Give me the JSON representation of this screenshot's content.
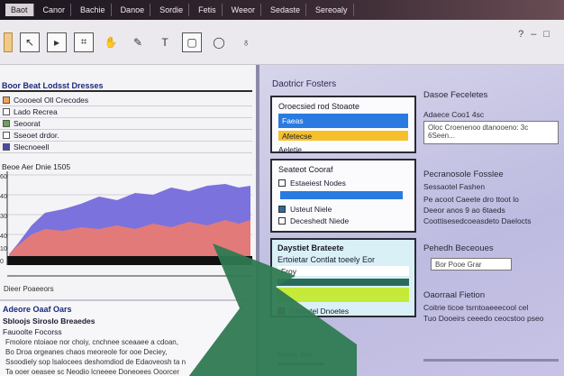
{
  "menu": [
    "Baot",
    "Canor",
    "Bachie",
    "Danoe",
    "Sordie",
    "Fetis",
    "Weeor",
    "Sedaste",
    "Sereoaly"
  ],
  "toolbar": {
    "tools": [
      "pointer",
      "select",
      "crop",
      "hand",
      "pen",
      "text",
      "shape",
      "chat",
      "bulb"
    ]
  },
  "left_panel": {
    "header": "Boor Beat Lodsst Dresses",
    "legend": [
      {
        "label": "Coooeol Oll Crecodes",
        "color": "#f0a35a"
      },
      {
        "label": "Lado Recrea",
        "color": "#ffffff"
      },
      {
        "label": "Seoorat",
        "color": "#6aa35a"
      },
      {
        "label": "Sseoet drdor.",
        "color": "#ffffff"
      },
      {
        "label": "Slecnoeell",
        "color": "#4d4aa8"
      }
    ],
    "chart": {
      "title": "Beoe Aer Dnie 1505",
      "y_ticks": [
        "60",
        "40",
        "30",
        "40",
        "10",
        "0"
      ]
    },
    "bottom_title": "Dieer Poaeeors",
    "section": {
      "header": "Adeore Oaaf Oars",
      "subheader": "Sbloojs Siroslo Breaedes",
      "item": "Fauoolte Focorss",
      "lines": [
        "Fmolore ntoiaoe nor choiy, cnchnee sceaaee a cdoan,",
        "Bo Droa orgeanes chaos meoreole for ooe Deciey,",
        "Ssoodiely sop lsalocees deshomdiod de Edaoveosh ta n",
        "Ta ooer oeasee sc Neodio lcneeee Doneoees Ooorcer"
      ]
    }
  },
  "right_panel": {
    "title": "Daotricr Fosters",
    "card1": {
      "header": "Oroecsied rod Stoaote",
      "bar1": "Faeas",
      "bar2": "Afetecse",
      "bar3": "Aeletie"
    },
    "card2": {
      "header": "Seateot Cooraf",
      "items": [
        "Estaeiest Nodes",
        "Usteut Niele",
        "Deceshedt Niede"
      ]
    },
    "card3": {
      "header": "Daystiet Brateete",
      "line": "Ertoietar Contlat toeely Eor",
      "bar": "Froy",
      "button": "Ganfotel Dnoetes"
    },
    "footer": "Dreah Bor.",
    "side": {
      "title1": "Dasoe Feceletes",
      "sub1": "Adaece Coo1 4sc",
      "input1": "Oloc Croenenoo dtanooeno: 3c 6Seen...",
      "title2": "Pecranosole Fosslee",
      "sub2": "Sessaotel Fashen",
      "text2": [
        "Pe acoot Caeete dro ttoot lo",
        "Deeor anos 9 ao 6taeds",
        "Coottisesedcoeasdeto Daelocts"
      ],
      "title3": "Pehedh Beceoues",
      "input3": "Bor Pooe Grar",
      "title4": "Oaorraal Fietion",
      "text4": [
        "Coitrie ticoe tsrntoaeeecool cel",
        "Tuo Dooeirs ceeedo ceocstoo pseo"
      ]
    }
  },
  "colors": {
    "accent_blue": "#2a7ae0",
    "accent_yellow": "#f5c02a",
    "accent_green": "#c6ea3a",
    "area_blue": "#7b72dd",
    "area_red": "#e37a7a",
    "arrow_green": "#2f7a52"
  }
}
